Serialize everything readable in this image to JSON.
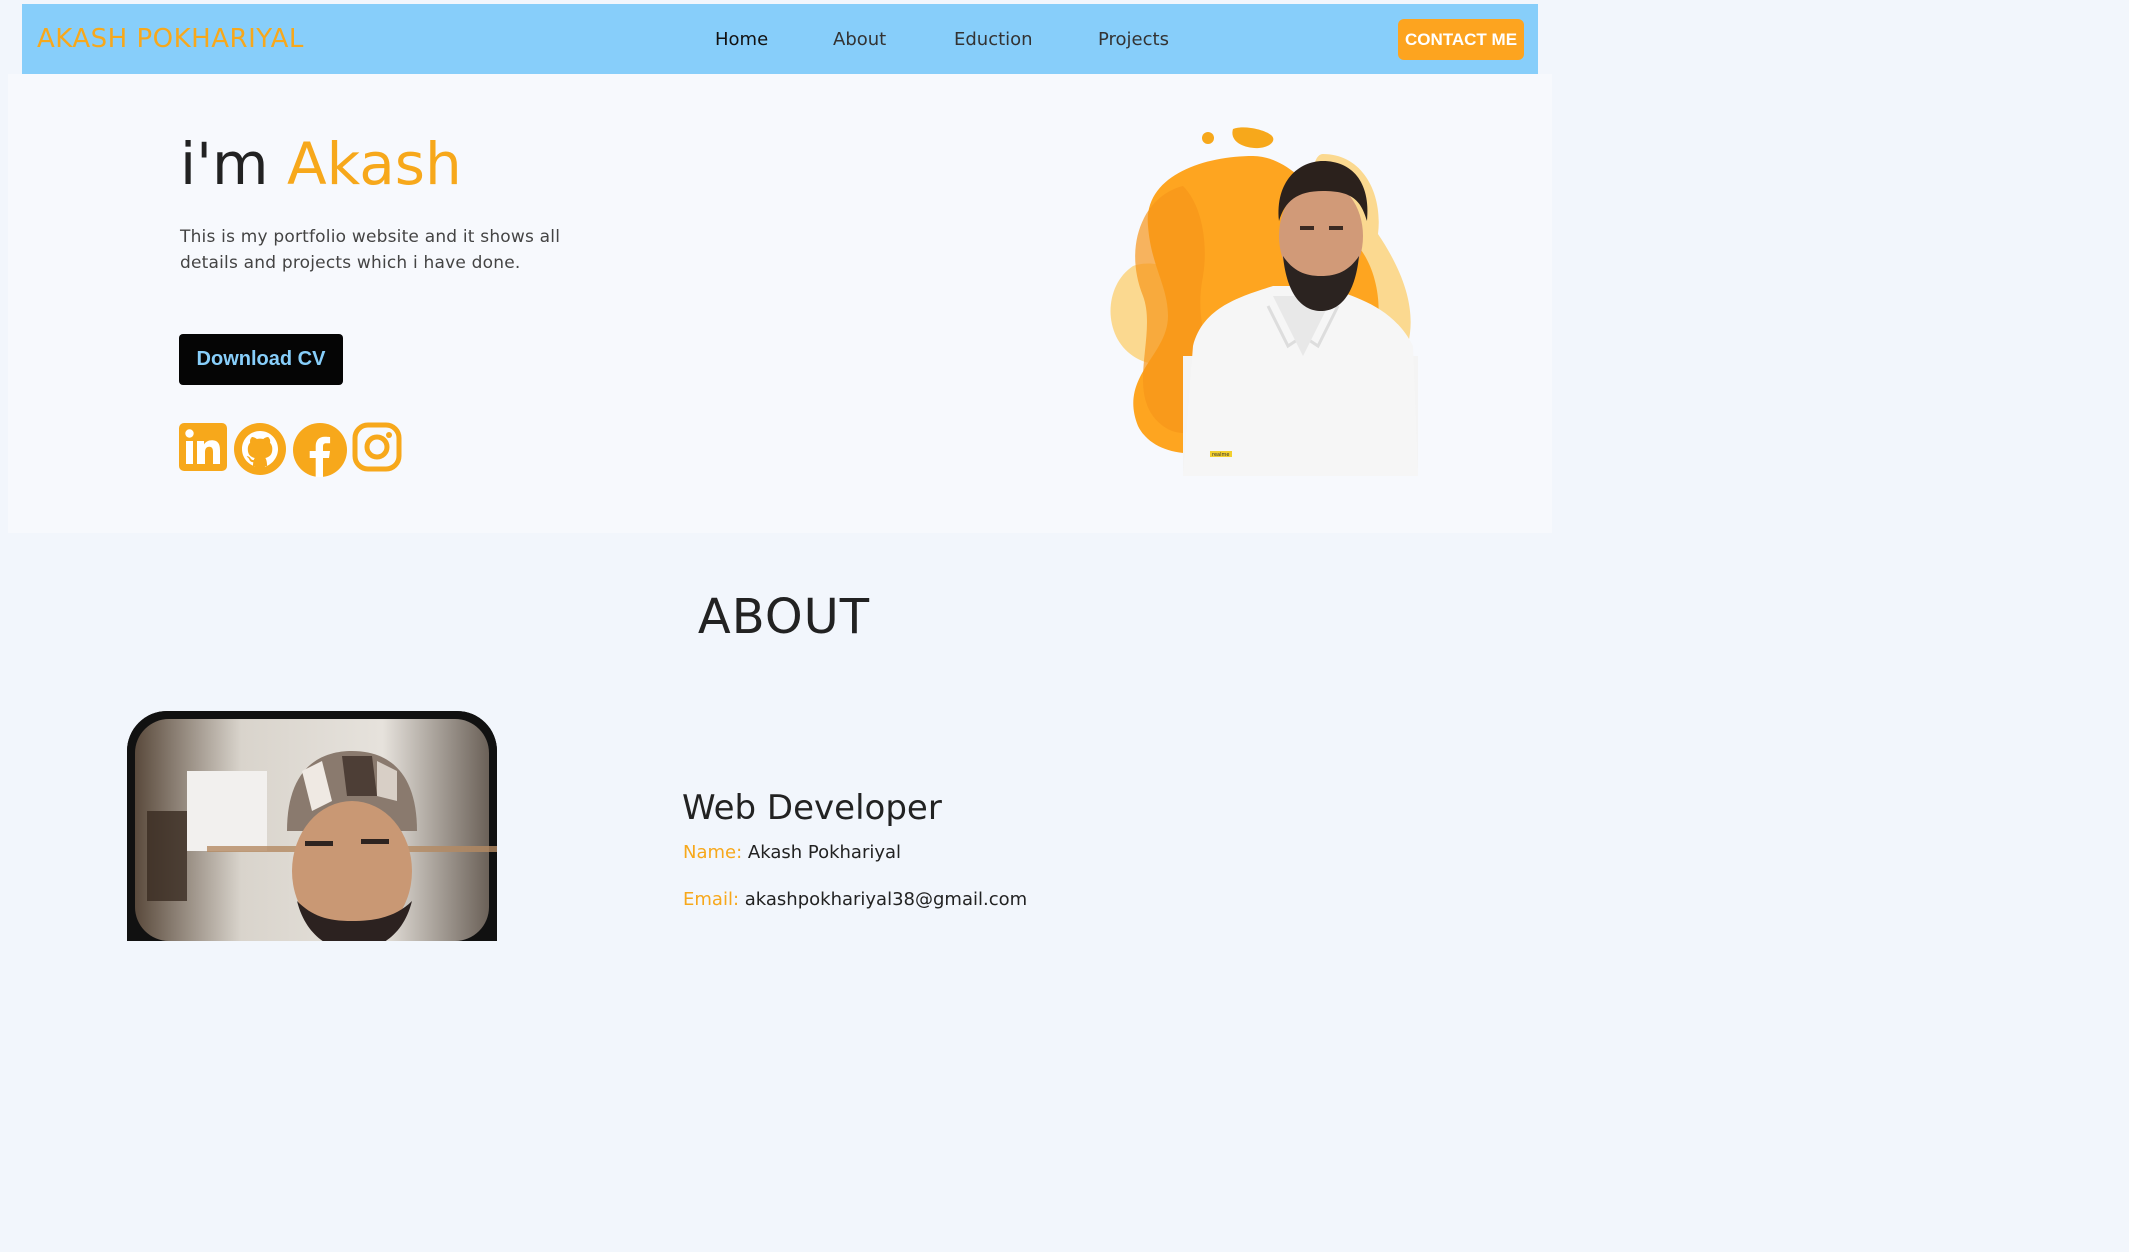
{
  "header": {
    "brand": "AKASH POKHARIYAL",
    "nav": [
      {
        "label": "Home"
      },
      {
        "label": "About"
      },
      {
        "label": "Eduction"
      },
      {
        "label": "Projects"
      }
    ],
    "contact_label": "CONTACT ME"
  },
  "hero": {
    "title_prefix": "i'm ",
    "title_name": "Akash",
    "description": "This is my portfolio website and it shows all details and projects which i have done.",
    "cv_label": "Download CV",
    "socials": [
      "linkedin-icon",
      "github-icon",
      "facebook-icon",
      "instagram-icon"
    ],
    "photo_watermark": "realme"
  },
  "about": {
    "title": "ABOUT",
    "role": "Web Developer",
    "name_label": "Name:",
    "name_value": "Akash Pokhariyal",
    "email_label": "Email:",
    "email_value": "akashpokhariyal38@gmail.com"
  },
  "colors": {
    "accent": "#f7a81b",
    "nav_bg": "#87cefa",
    "button_dark": "#050505"
  }
}
